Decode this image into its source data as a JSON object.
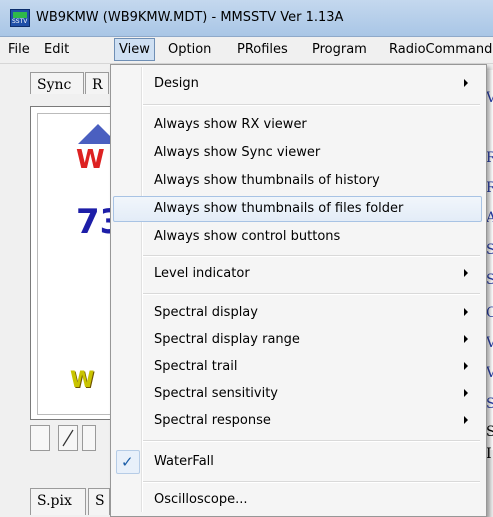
{
  "window": {
    "title": "WB9KMW (WB9KMW.MDT) - MMSSTV Ver 1.13A",
    "icon_text": "SSTV"
  },
  "menubar": {
    "items": [
      "File",
      "Edit",
      "View",
      "Option",
      "PRofiles",
      "Program",
      "RadioCommand"
    ],
    "active": "View"
  },
  "tabs_top": [
    "Sync",
    "R"
  ],
  "tabs_bottom": [
    "S.pix",
    "S"
  ],
  "picture_text": {
    "w": "W",
    "num": "73",
    "y": "W"
  },
  "right_strip_letters": [
    "V",
    "R",
    "R",
    "A",
    "S",
    "S",
    "C",
    "V",
    "V",
    "S",
    "S",
    "I"
  ],
  "view_menu": {
    "items": [
      {
        "label": "Design",
        "submenu": true
      },
      {
        "label": "Always show RX viewer"
      },
      {
        "label": "Always show Sync viewer"
      },
      {
        "label": "Always show thumbnails of history"
      },
      {
        "label": "Always show thumbnails of files folder",
        "highlighted": true
      },
      {
        "label": "Always show control buttons"
      },
      {
        "label": "Level indicator",
        "submenu": true
      },
      {
        "label": "Spectral display",
        "submenu": true
      },
      {
        "label": "Spectral display range",
        "submenu": true
      },
      {
        "label": "Spectral trail",
        "submenu": true
      },
      {
        "label": "Spectral sensitivity",
        "submenu": true
      },
      {
        "label": "Spectral response",
        "submenu": true
      },
      {
        "label": "WaterFall",
        "checked": true
      },
      {
        "label": "Oscilloscope..."
      }
    ],
    "check_glyph": "✓"
  },
  "colors": {
    "menu_highlight": "#e3ecf7",
    "check": "#1c5ea8",
    "title_bar": "#b7cfe9"
  }
}
